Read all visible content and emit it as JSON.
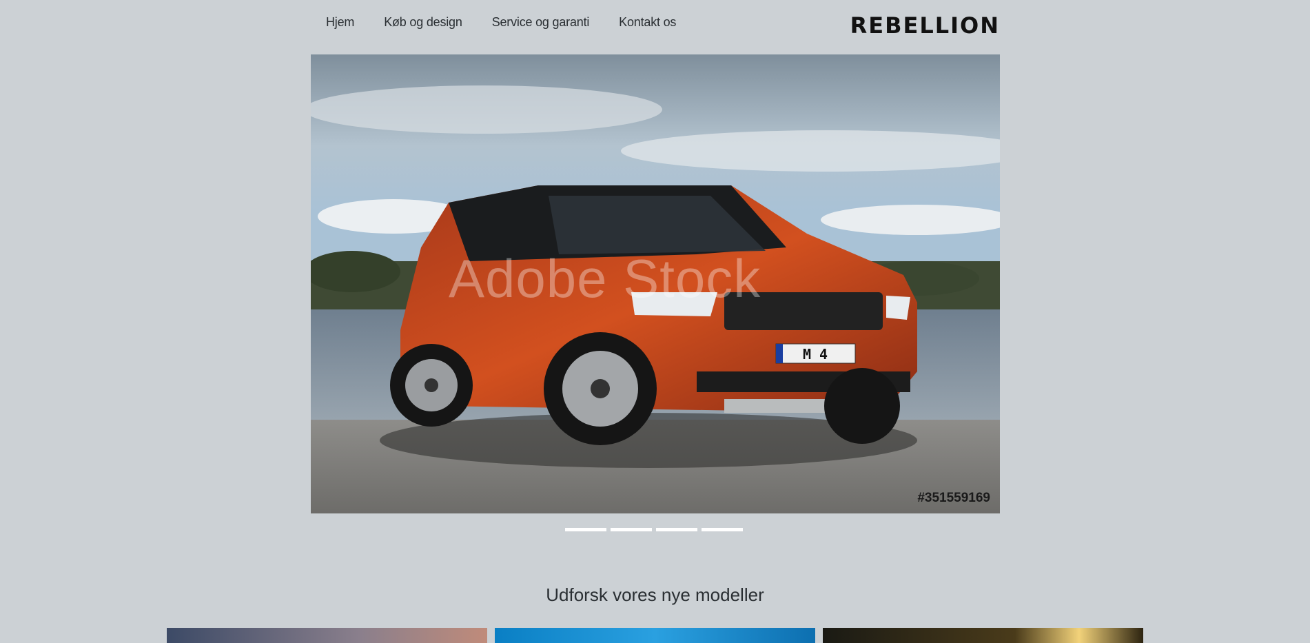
{
  "nav": {
    "items": [
      {
        "label": "Hjem"
      },
      {
        "label": "Køb og design"
      },
      {
        "label": "Service og garanti"
      },
      {
        "label": "Kontakt os"
      }
    ],
    "logo": "REBELLION"
  },
  "hero": {
    "image_tag": "#351559169",
    "watermark": "Adobe Stock",
    "plate": "M 4",
    "slides": 4
  },
  "section": {
    "title": "Udforsk vores nye modeller"
  },
  "colors": {
    "background": "#ccd1d5",
    "accent": "#ffffff",
    "car": "#c2451e"
  }
}
